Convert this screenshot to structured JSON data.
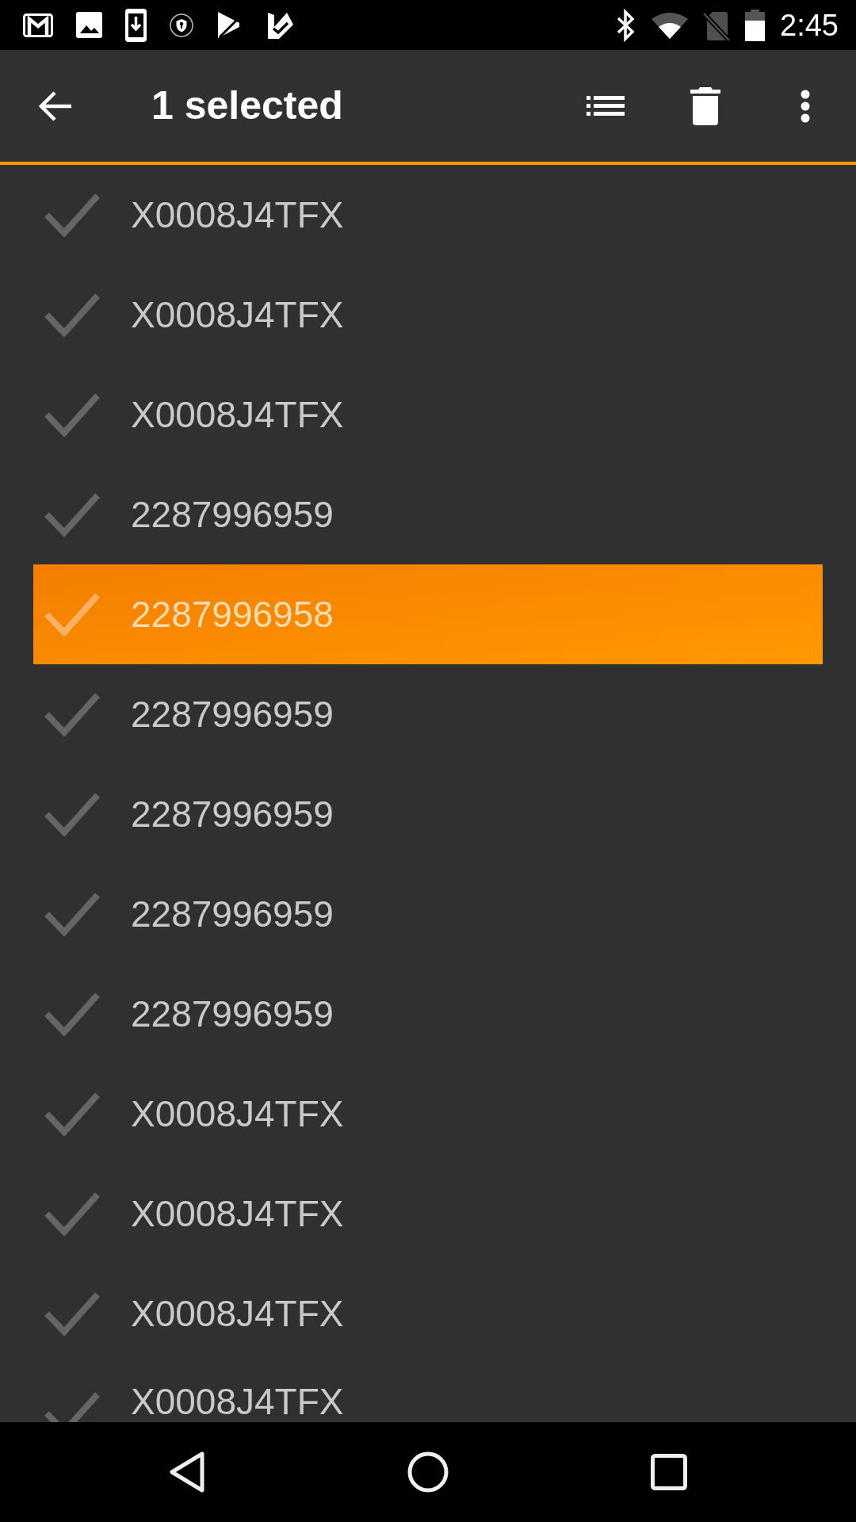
{
  "status_bar": {
    "time": "2:45"
  },
  "toolbar": {
    "title": "1 selected"
  },
  "items": [
    {
      "code": "X0008J4TFX",
      "selected": false
    },
    {
      "code": "X0008J4TFX",
      "selected": false
    },
    {
      "code": "X0008J4TFX",
      "selected": false
    },
    {
      "code": "2287996959",
      "selected": false
    },
    {
      "code": "2287996958",
      "selected": true
    },
    {
      "code": "2287996959",
      "selected": false
    },
    {
      "code": "2287996959",
      "selected": false
    },
    {
      "code": "2287996959",
      "selected": false
    },
    {
      "code": "2287996959",
      "selected": false
    },
    {
      "code": "X0008J4TFX",
      "selected": false
    },
    {
      "code": "X0008J4TFX",
      "selected": false
    },
    {
      "code": "X0008J4TFX",
      "selected": false
    },
    {
      "code": "X0008J4TFX",
      "selected": false
    }
  ]
}
